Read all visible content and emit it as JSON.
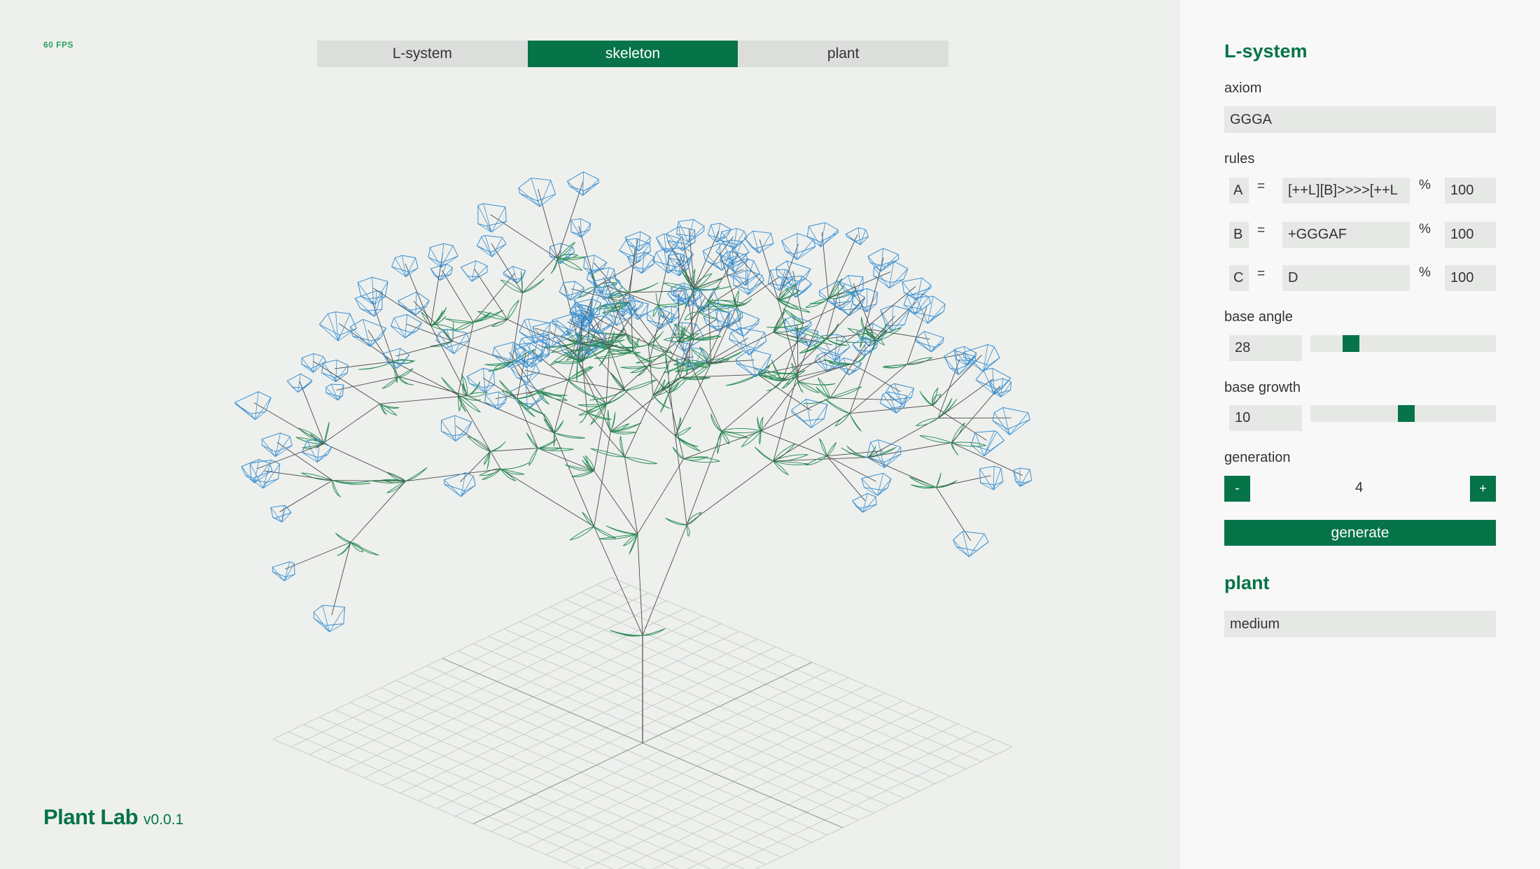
{
  "overlay": {
    "fps": "60 FPS"
  },
  "tabs": [
    {
      "label": "L-system",
      "active": false
    },
    {
      "label": "skeleton",
      "active": true
    },
    {
      "label": "plant",
      "active": false
    }
  ],
  "brand": {
    "name": "Plant Lab",
    "version": "v0.0.1"
  },
  "colors": {
    "accent": "#067349",
    "leaf": "#2f8f5b",
    "flower": "#3b8fd0",
    "branch": "#4a4a4a",
    "grid": "#c9cdc9"
  },
  "panel": {
    "lsystem_title": "L-system",
    "axiom_label": "axiom",
    "axiom_value": "GGGA",
    "rules_label": "rules",
    "rules": [
      {
        "symbol": "A",
        "equals": "=",
        "rule": "[++L][B]>>>>[++L",
        "percent_sign": "%",
        "percent": "100"
      },
      {
        "symbol": "B",
        "equals": "=",
        "rule": "+GGGAF",
        "percent_sign": "%",
        "percent": "100"
      },
      {
        "symbol": "C",
        "equals": "=",
        "rule": "D",
        "percent_sign": "%",
        "percent": "100"
      }
    ],
    "base_angle_label": "base angle",
    "base_angle_value": "28",
    "base_angle_level": 0.19,
    "base_growth_label": "base growth",
    "base_growth_value": "10",
    "base_growth_level": 0.52,
    "generation_label": "generation",
    "generation_minus": "-",
    "generation_value": "4",
    "generation_plus": "+",
    "generate_label": "generate",
    "plant_title": "plant",
    "plant_size": "medium"
  }
}
